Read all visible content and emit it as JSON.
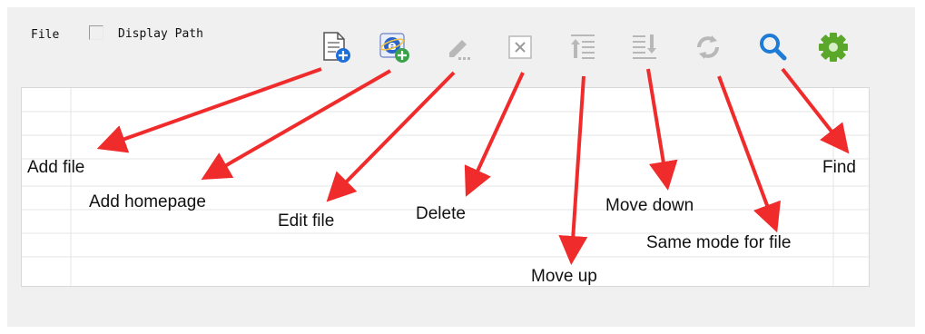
{
  "toolbar": {
    "file_label": "File",
    "display_path_label": "Display Path",
    "display_path_checked": false
  },
  "icons": [
    "add-file-icon",
    "add-homepage-icon",
    "edit-file-icon",
    "delete-icon",
    "move-up-icon",
    "move-down-icon",
    "same-mode-icon",
    "find-icon",
    "settings-icon"
  ],
  "annotations": {
    "add_file": "Add file",
    "add_homepage": "Add homepage",
    "edit_file": "Edit file",
    "delete": "Delete",
    "move_up": "Move up",
    "move_down": "Move down",
    "same_mode": "Same mode for file",
    "find": "Find"
  },
  "colors": {
    "arrow": "#f02b2b",
    "find_icon": "#1e7bd6",
    "settings_icon": "#5aa72a",
    "add_badge": "#1e6fd9",
    "homepage_badge": "#3aa34a",
    "disabled_icon": "#b8b8b8"
  }
}
